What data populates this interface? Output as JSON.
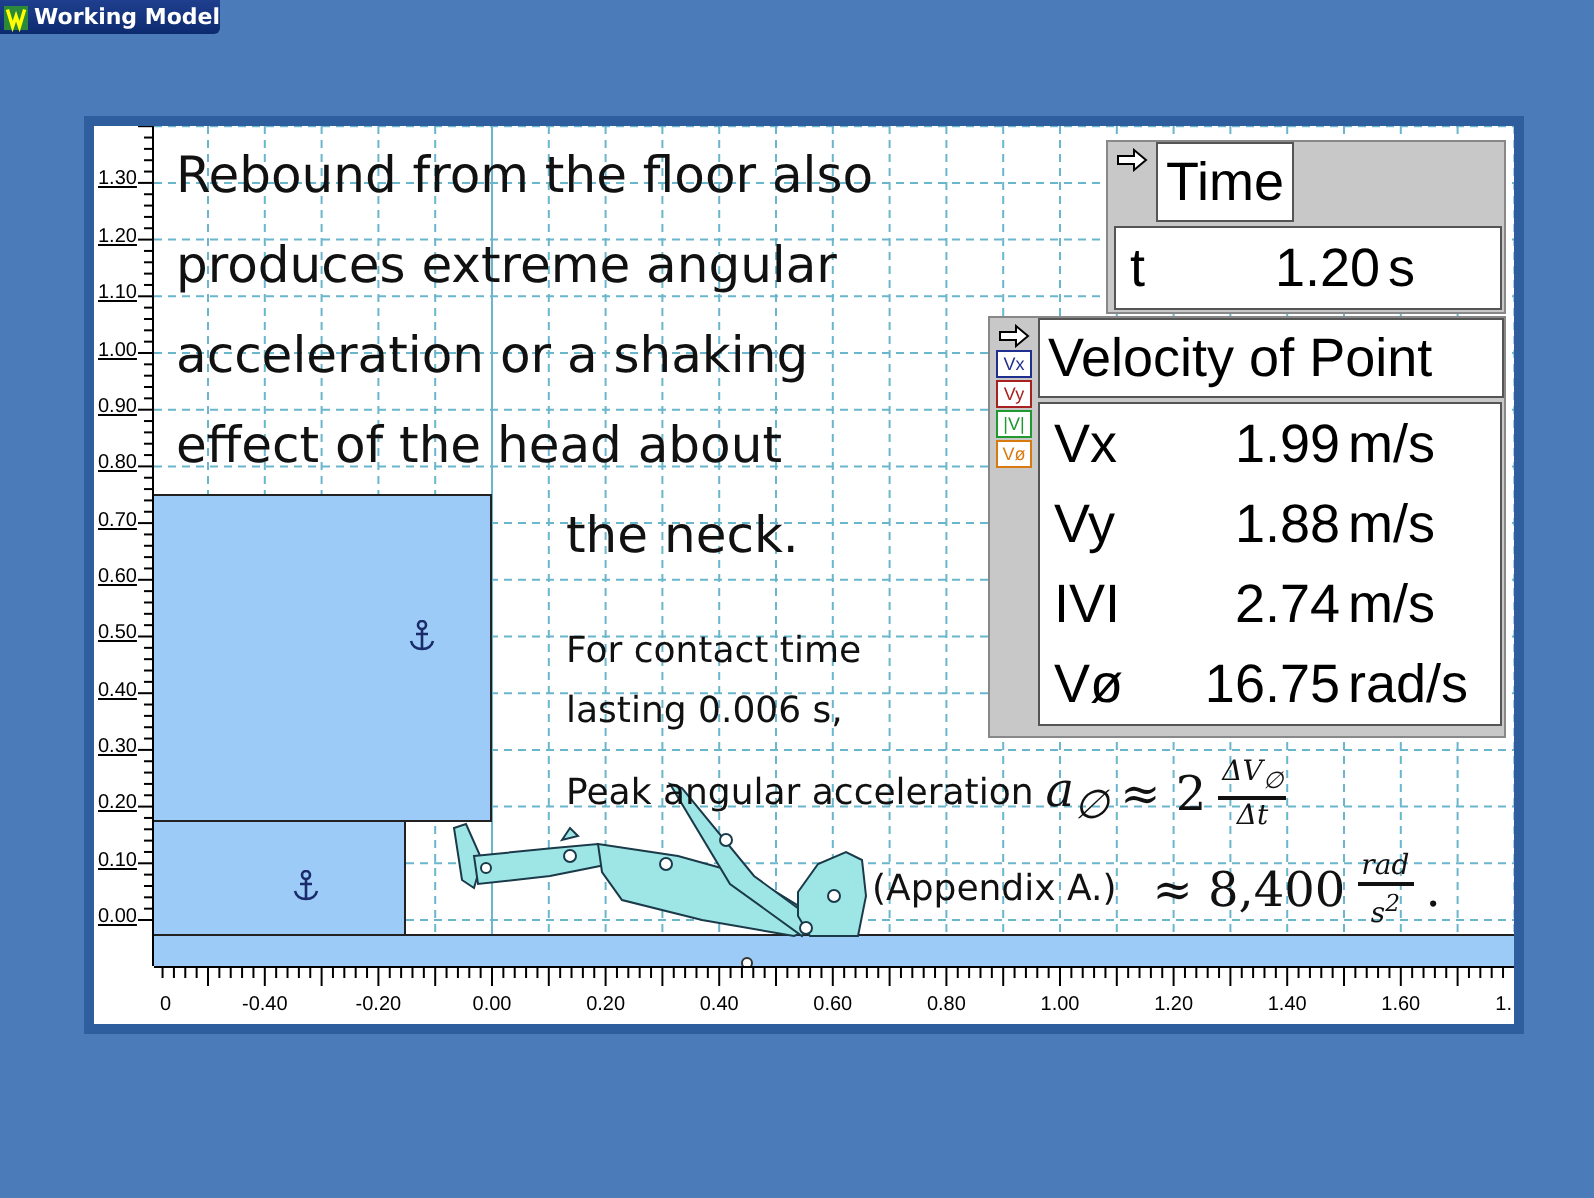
{
  "app": {
    "title": "Working Model"
  },
  "workspace": {
    "caption": {
      "lines": [
        "Rebound from the floor also",
        "produces extreme angular",
        "acceleration or a shaking",
        "effect of the head about",
        "the neck."
      ]
    },
    "note": {
      "lines": [
        "For contact time",
        "lasting 0.006 s,"
      ]
    },
    "equation": {
      "label": "Peak angular acceleration",
      "symbol": "a$_{∅}$",
      "relation": "≈ 2",
      "numerator": "ΔV$_{∅}$",
      "denominator": "Δt"
    },
    "reference": "(Appendix A.)",
    "result": {
      "relation": "≈ 8,400",
      "numerator": "rad",
      "denominator": "s$^{2}$",
      "end": "."
    },
    "y_ruler": [
      "1.30",
      "1.20",
      "1.10",
      "1.00",
      "0.90",
      "0.80",
      "0.70",
      "0.60",
      "0.50",
      "0.40",
      "0.30",
      "0.20",
      "0.10",
      "0.00"
    ],
    "x_ruler": [
      "0",
      "-0.40",
      "-0.20",
      "0.00",
      "0.20",
      "0.40",
      "0.60",
      "0.80",
      "1.00",
      "1.20",
      "1.40",
      "1.60",
      "1."
    ]
  },
  "time_meter": {
    "title": "Time",
    "rows": [
      {
        "label": "t",
        "value": "1.20",
        "unit": "s"
      }
    ]
  },
  "velocity_meter": {
    "title": "Velocity of Point",
    "legend": [
      {
        "label": "Vx",
        "color": "#1f2f8f"
      },
      {
        "label": "Vy",
        "color": "#a82020"
      },
      {
        "label": "|V|",
        "color": "#1f9a2f"
      },
      {
        "label": "Vø",
        "color": "#d97a10"
      }
    ],
    "rows": [
      {
        "label": "Vx",
        "value": "1.99",
        "unit": "m/s"
      },
      {
        "label": "Vy",
        "value": "1.88",
        "unit": "m/s"
      },
      {
        "label": "IVI",
        "value": "2.74",
        "unit": "m/s"
      },
      {
        "label": "Vø",
        "value": "16.75",
        "unit": "rad/s"
      }
    ]
  }
}
